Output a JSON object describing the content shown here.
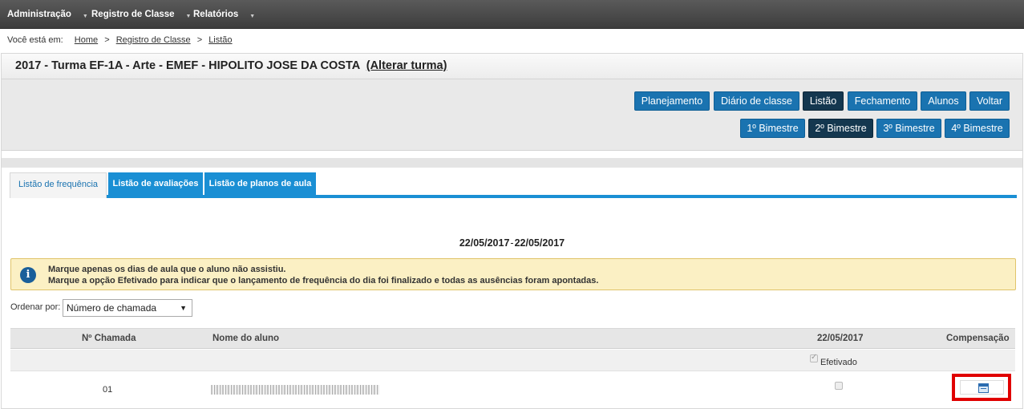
{
  "nav": {
    "items": [
      {
        "label": "Administração"
      },
      {
        "label": "Registro de Classe"
      },
      {
        "label": "Relatórios"
      }
    ],
    "caret": "▼"
  },
  "breadcrumb": {
    "prefix": "Você está em:",
    "items": [
      "Home",
      "Registro de Classe",
      "Listão"
    ],
    "separator": ">"
  },
  "header": {
    "title": "2017 - Turma EF-1A - Arte - EMEF - HIPOLITO JOSE DA COSTA",
    "change_link": "(Alterar turma)"
  },
  "toolbar": {
    "buttons": [
      "Planejamento",
      "Diário de classe",
      "Listão",
      "Fechamento",
      "Alunos",
      "Voltar"
    ],
    "active_button": "Listão",
    "bimestres": [
      "1º Bimestre",
      "2º Bimestre",
      "3º Bimestre",
      "4º Bimestre"
    ],
    "active_bimestre": "2º Bimestre"
  },
  "tabs": {
    "items": [
      "Listão de frequência",
      "Listão de avaliações",
      "Listão de planos de aula"
    ],
    "active": "Listão de frequência"
  },
  "date_range": {
    "start": "22/05/2017",
    "separator": "-",
    "end": "22/05/2017"
  },
  "alert": {
    "line1": "Marque apenas os dias de aula que o aluno não assistiu.",
    "line2": "Marque a opção Efetivado para indicar que o lançamento de frequência do dia foi finalizado e todas as ausências foram apontadas.",
    "icon": "info-icon"
  },
  "order": {
    "label": "Ordenar por:",
    "selected": "Número de chamada"
  },
  "table": {
    "headers": {
      "number": "Nº Chamada",
      "name": "Nome do aluno",
      "date": "22/05/2017",
      "compensation": "Compensação"
    },
    "efetivado_label": "Efetivado",
    "rows": [
      {
        "number": "01",
        "name": "",
        "present_checked": false
      }
    ]
  },
  "colors": {
    "primary": "#1a73b0",
    "active": "#14374f",
    "tab_blue": "#1a8fd4",
    "alert_bg": "#fbf0c4",
    "highlight": "#e00000"
  }
}
